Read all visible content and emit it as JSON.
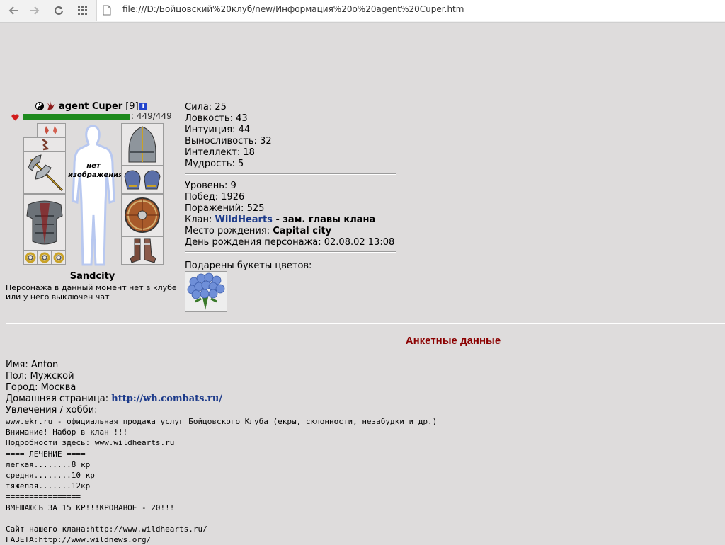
{
  "browser": {
    "url": "file:///D:/Бойцовский%20клуб/new/Информация%20о%20agent%20Cuper.htm"
  },
  "character": {
    "name": "agent Cuper",
    "level": "[9]",
    "info_icon": "i",
    "hp": ": 449/449",
    "doll_label": [
      "нет",
      "изображения"
    ],
    "location": "Sandcity",
    "status_message": "Персонажа в данный момент нет в клубе или у него выключен чат"
  },
  "stats": [
    "Сила: 25",
    "Ловкость: 43",
    "Интуиция: 44",
    "Выносливость: 32",
    "Интеллект: 18",
    "Мудрость: 5"
  ],
  "info": {
    "level": "Уровень: 9",
    "wins": "Побед: 1926",
    "losses": "Поражений: 525",
    "clan_label": "Клан: ",
    "clan_name": "WildHearts",
    "clan_role": " - зам. главы клана",
    "birthplace_label": "Место рождения: ",
    "birthplace": "Capital city",
    "birthday": "День рождения персонажа: 02.08.02 13:08"
  },
  "flowers_title": "Подарены букеты цветов:",
  "profile": {
    "title": "Анкетные данные",
    "name": "Имя: Anton",
    "gender": "Пол: Мужской",
    "city": "Город: Москва",
    "homepage_label": "Домашняя страница: ",
    "homepage": "http://wh.combats.ru/",
    "hobby_label": "Увлечения / хобби:",
    "hobby_lines": "www.ekr.ru - официальная продажа услуг Бойцовского Клуба (екры, склонности, незабудки и др.)\nВнимание! Набор в клан !!!\nПодробности здесь: www.wildhearts.ru\n==== ЛЕЧЕНИЕ ====\nлегкая........8 кр\nсредня........10 кр\nтяжелая.......12кр\n================\nВМЕШАЮСЬ ЗА 15 КР!!!КРОВАВОЕ - 20!!!\n\nСайт нашего клана:http://www.wildhearts.ru/\nГАЗЕТА:http://www.wildnews.org/"
  }
}
